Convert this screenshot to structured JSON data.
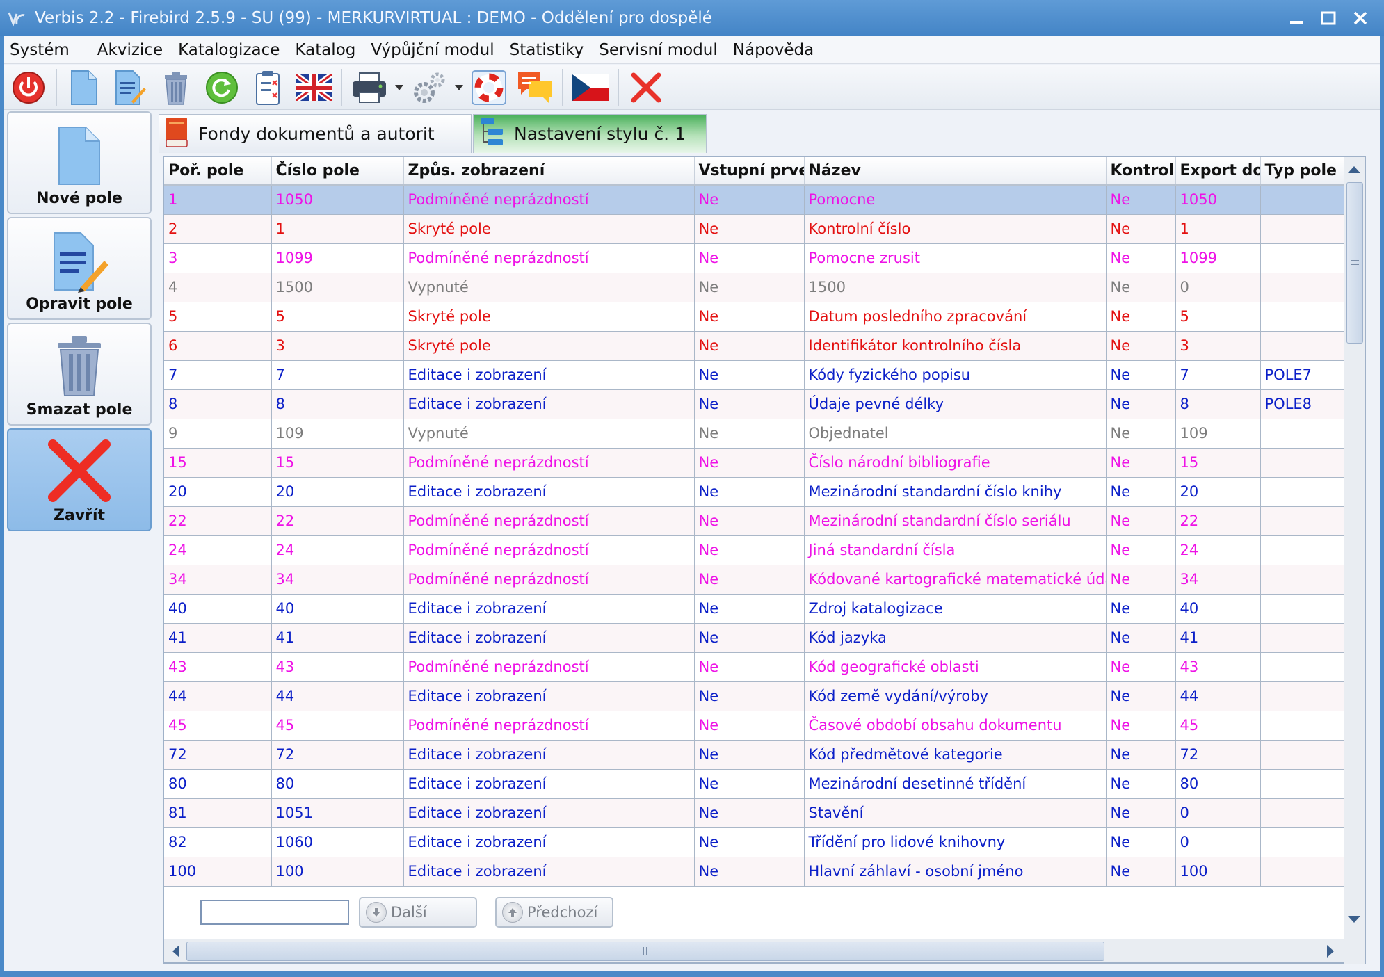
{
  "window": {
    "title": "Verbis 2.2 - Firebird 2.5.9 - SU (99) - MERKURVIRTUAL : DEMO - Oddělení pro dospělé"
  },
  "menu": [
    "Systém",
    "Akvizice",
    "Katalogizace",
    "Katalog",
    "Výpůjční modul",
    "Statistiky",
    "Servisní modul",
    "Nápověda"
  ],
  "toolbar": {
    "icons": [
      "power-icon",
      "new-document-icon",
      "edit-document-icon",
      "trash-icon",
      "refresh-icon",
      "clipboard-icon",
      "uk-flag-icon",
      "printer-icon",
      "gear-icon",
      "lifebuoy-icon",
      "chat-icon",
      "czech-flag-icon",
      "close-icon"
    ]
  },
  "side": {
    "new_field": "Nové pole",
    "edit_field": "Opravit pole",
    "delete_field": "Smazat pole",
    "close": "Zavřít"
  },
  "tabs": {
    "fonds": "Fondy dokumentů a autorit",
    "style": "Nastavení stylu č. 1"
  },
  "grid": {
    "headers": [
      "Poř. pole",
      "Číslo pole",
      "Způs. zobrazení",
      "Vstupní prvel",
      "Název",
      "Kontrol.",
      "Export do",
      "Typ pole"
    ],
    "rows": [
      {
        "c": [
          "1",
          "1050",
          "Podmíněné neprázdností",
          "Ne",
          "Pomocne",
          "Ne",
          "1050",
          ""
        ],
        "color": "magenta",
        "selected": true
      },
      {
        "c": [
          "2",
          "1",
          "Skryté pole",
          "Ne",
          "Kontrolní číslo",
          "Ne",
          "1",
          ""
        ],
        "color": "red"
      },
      {
        "c": [
          "3",
          "1099",
          "Podmíněné neprázdností",
          "Ne",
          "Pomocne zrusit",
          "Ne",
          "1099",
          ""
        ],
        "color": "magenta"
      },
      {
        "c": [
          "4",
          "1500",
          "Vypnuté",
          "Ne",
          "1500",
          "Ne",
          "0",
          ""
        ],
        "color": "gray"
      },
      {
        "c": [
          "5",
          "5",
          "Skryté pole",
          "Ne",
          "Datum posledního zpracování",
          "Ne",
          "5",
          ""
        ],
        "color": "red"
      },
      {
        "c": [
          "6",
          "3",
          "Skryté pole",
          "Ne",
          "Identifikátor kontrolního čísla",
          "Ne",
          "3",
          ""
        ],
        "color": "red"
      },
      {
        "c": [
          "7",
          "7",
          "Editace i zobrazení",
          "Ne",
          "Kódy fyzického popisu",
          "Ne",
          "7",
          "POLE7"
        ],
        "color": "blue"
      },
      {
        "c": [
          "8",
          "8",
          "Editace i zobrazení",
          "Ne",
          "Údaje pevné délky",
          "Ne",
          "8",
          "POLE8"
        ],
        "color": "blue"
      },
      {
        "c": [
          "9",
          "109",
          "Vypnuté",
          "Ne",
          "Objednatel",
          "Ne",
          "109",
          ""
        ],
        "color": "gray"
      },
      {
        "c": [
          "15",
          "15",
          "Podmíněné neprázdností",
          "Ne",
          "Číslo národní bibliografie",
          "Ne",
          "15",
          ""
        ],
        "color": "magenta"
      },
      {
        "c": [
          "20",
          "20",
          "Editace i zobrazení",
          "Ne",
          "Mezinárodní standardní číslo knihy",
          "Ne",
          "20",
          ""
        ],
        "color": "blue"
      },
      {
        "c": [
          "22",
          "22",
          "Podmíněné neprázdností",
          "Ne",
          "Mezinárodní standardní číslo seriálu",
          "Ne",
          "22",
          ""
        ],
        "color": "magenta"
      },
      {
        "c": [
          "24",
          "24",
          "Podmíněné neprázdností",
          "Ne",
          "Jiná standardní čísla",
          "Ne",
          "24",
          ""
        ],
        "color": "magenta"
      },
      {
        "c": [
          "34",
          "34",
          "Podmíněné neprázdností",
          "Ne",
          "Kódované kartografické matematické údaje",
          "Ne",
          "34",
          ""
        ],
        "color": "magenta"
      },
      {
        "c": [
          "40",
          "40",
          "Editace i zobrazení",
          "Ne",
          "Zdroj katalogizace",
          "Ne",
          "40",
          ""
        ],
        "color": "blue"
      },
      {
        "c": [
          "41",
          "41",
          "Editace i zobrazení",
          "Ne",
          "Kód jazyka",
          "Ne",
          "41",
          ""
        ],
        "color": "blue"
      },
      {
        "c": [
          "43",
          "43",
          "Podmíněné neprázdností",
          "Ne",
          "Kód geografické oblasti",
          "Ne",
          "43",
          ""
        ],
        "color": "magenta"
      },
      {
        "c": [
          "44",
          "44",
          "Editace i zobrazení",
          "Ne",
          "Kód země vydání/výroby",
          "Ne",
          "44",
          ""
        ],
        "color": "blue"
      },
      {
        "c": [
          "45",
          "45",
          "Podmíněné neprázdností",
          "Ne",
          "Časové období obsahu dokumentu",
          "Ne",
          "45",
          ""
        ],
        "color": "magenta"
      },
      {
        "c": [
          "72",
          "72",
          "Editace i zobrazení",
          "Ne",
          "Kód předmětové kategorie",
          "Ne",
          "72",
          ""
        ],
        "color": "blue"
      },
      {
        "c": [
          "80",
          "80",
          "Editace i zobrazení",
          "Ne",
          "Mezinárodní desetinné třídění",
          "Ne",
          "80",
          ""
        ],
        "color": "blue"
      },
      {
        "c": [
          "81",
          "1051",
          "Editace i zobrazení",
          "Ne",
          "Stavění",
          "Ne",
          "0",
          ""
        ],
        "color": "blue"
      },
      {
        "c": [
          "82",
          "1060",
          "Editace i zobrazení",
          "Ne",
          "Třídění pro lidové knihovny",
          "Ne",
          "0",
          ""
        ],
        "color": "blue"
      },
      {
        "c": [
          "100",
          "100",
          "Editace i zobrazení",
          "Ne",
          "Hlavní záhlaví - osobní jméno",
          "Ne",
          "100",
          ""
        ],
        "color": "blue"
      }
    ]
  },
  "search": {
    "value": "",
    "next_label": "Další",
    "prev_label": "Předchozí"
  },
  "colors": {
    "blue": "#0b1fc8",
    "magenta": "#ee12e6",
    "red": "#e31010",
    "gray": "#7d7d7d",
    "selection": "#b6ccea",
    "active_tab": "#4ab05b"
  }
}
